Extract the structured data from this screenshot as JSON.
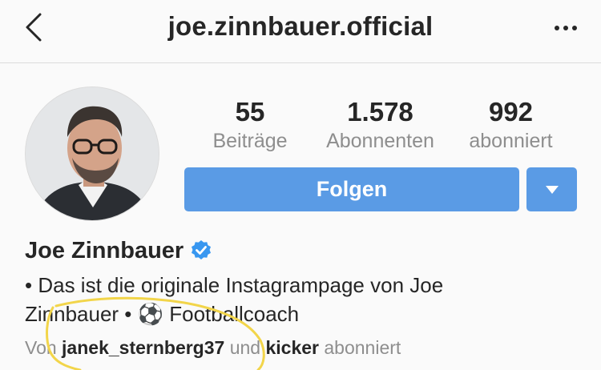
{
  "header": {
    "username": "joe.zinnbauer.official",
    "back_icon": "chevron-left-icon",
    "more_icon": "more-horizontal-icon"
  },
  "profile": {
    "avatar_icon": "profile-photo",
    "stats": [
      {
        "count": "55",
        "label": "Beiträge"
      },
      {
        "count": "1.578",
        "label": "Abonnenten"
      },
      {
        "count": "992",
        "label": "abonniert"
      }
    ],
    "follow_label": "Folgen",
    "dropdown_icon": "caret-down-icon",
    "full_name": "Joe Zinnbauer",
    "verified_icon": "verified-badge-icon",
    "bio_line1": "• Das ist die originale Instagrampage von Joe",
    "bio_line2_start": "Zinnbauer •",
    "bio_emoji": "⚽️",
    "bio_line2_end": "Footballcoach",
    "followed_by_prefix": "Von",
    "followed_by_user1": "janek_sternberg37",
    "followed_by_and": "und",
    "followed_by_user2": "kicker",
    "followed_by_suffix": "abonniert"
  },
  "colors": {
    "accent": "#5a9be5",
    "secondary_text": "#8e8e8e",
    "annotation": "#f2d54a",
    "verified": "#3897f0"
  }
}
